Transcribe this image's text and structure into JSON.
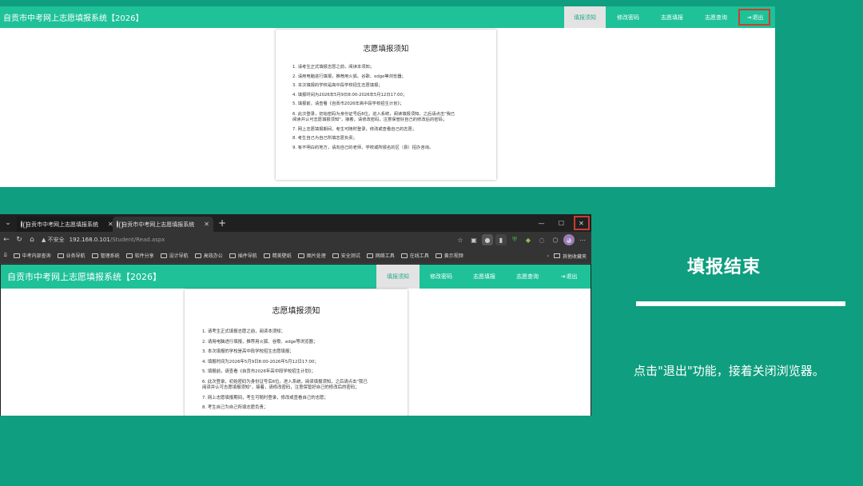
{
  "app": {
    "title": "自贡市中考网上志愿填报系统【2026】",
    "nav": [
      {
        "label": "填报须知",
        "active": true
      },
      {
        "label": "修改密码",
        "active": false
      },
      {
        "label": "志愿填报",
        "active": false
      },
      {
        "label": "志愿查询",
        "active": false
      },
      {
        "label": "退出",
        "active": false,
        "icon": "logout-icon"
      }
    ],
    "notice": {
      "title": "志愿填报须知",
      "items": [
        "1. 请考生正式填报志愿之前，阅读本须知；",
        "2. 请用电脑进行填报，推荐用火狐、谷歌、edge等浏览器；",
        "3. 本次填报的学校是高中段学校招生志愿填报；",
        "4. 填报时间为2026年5月9日8:00-2026年5月12日17:00；",
        "5. 填报前，请查看《自贡市2026年高中段学校招生计划》；",
        "6. 此次登录，初始密码为身份证号后6位。进入系统，阅读填报须知，之后请点击\"我已",
        "阅读并认可志愿填报须知\"，接着，请修改密码，注意保管好自己的修改后的密码；",
        "7. 网上志愿填报期间，考生可随时登录，修改或查看自己的志愿；",
        "8. 考生自己为自己所填志愿负责；",
        "9. 有不明白的地方，请向自己的老师、学校或所报名的区（县）招办咨询。"
      ]
    },
    "colors": {
      "bar": "#1ec198",
      "highlight": "#cf3b30",
      "background": "#0f9e7f"
    }
  },
  "browser": {
    "tabs": [
      {
        "title": "自贡市中考网上志愿填报系统",
        "active": false
      },
      {
        "title": "自贡市中考网上志愿填报系统",
        "active": true
      }
    ],
    "new_tab": "+",
    "window_controls": {
      "minimize": "—",
      "maximize": "☐",
      "close": "✕"
    },
    "security_label": "不安全",
    "url_host": "192.168.0.101",
    "url_path": "/Student/Read.aspx",
    "bookmarks": [
      "中考内部查询",
      "业务导航",
      "管理系统",
      "软件分享",
      "设计导航",
      "高效办公",
      "插件导航",
      "精美壁纸",
      "图片处理",
      "安全测试",
      "网络工具",
      "在线工具",
      "黄示视频"
    ],
    "other_bookmarks": "其他收藏夹"
  },
  "panel": {
    "heading": "填报结束",
    "description": "点击\"退出\"功能，接着关闭浏览器。"
  }
}
